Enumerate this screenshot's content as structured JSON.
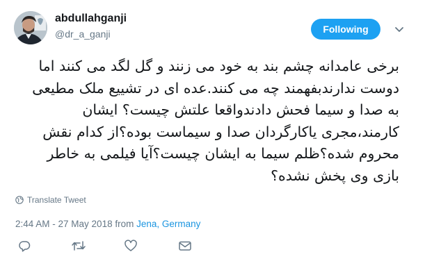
{
  "user": {
    "display_name": "abdullahganji",
    "handle": "@dr_a_ganji"
  },
  "follow_button_label": "Following",
  "tweet": {
    "lines": [
      "برخی عامدانه چشم بند به خود می زنند و گل لگد می کنند اما",
      "دوست ندارندبفهمند چه می کنند.عده ای در تشییع ملک مطیعی",
      "به صدا و سیما فحش دادندواقعا علتش چیست؟ ایشان",
      "کارمند،مجری یاکارگردان صدا و سیماست بوده؟از کدام نقش",
      "محروم شده؟ظلم سیما به ایشان چیست؟آیا فیلمی به خاطر",
      "بازی وی پخش نشده؟"
    ]
  },
  "translate_label": "Translate Tweet",
  "meta": {
    "time_date": "2:44 AM - 27 May 2018 from ",
    "location": "Jena, Germany"
  },
  "icons": {
    "avatar": "user-avatar",
    "caret": "chevron-down-icon",
    "globe": "globe-icon",
    "reply": "reply-icon",
    "retweet": "retweet-icon",
    "like": "heart-icon",
    "dm": "envelope-icon"
  },
  "colors": {
    "accent": "#1da1f2",
    "link": "#1b95e0",
    "muted": "#657786",
    "text": "#14171a"
  }
}
